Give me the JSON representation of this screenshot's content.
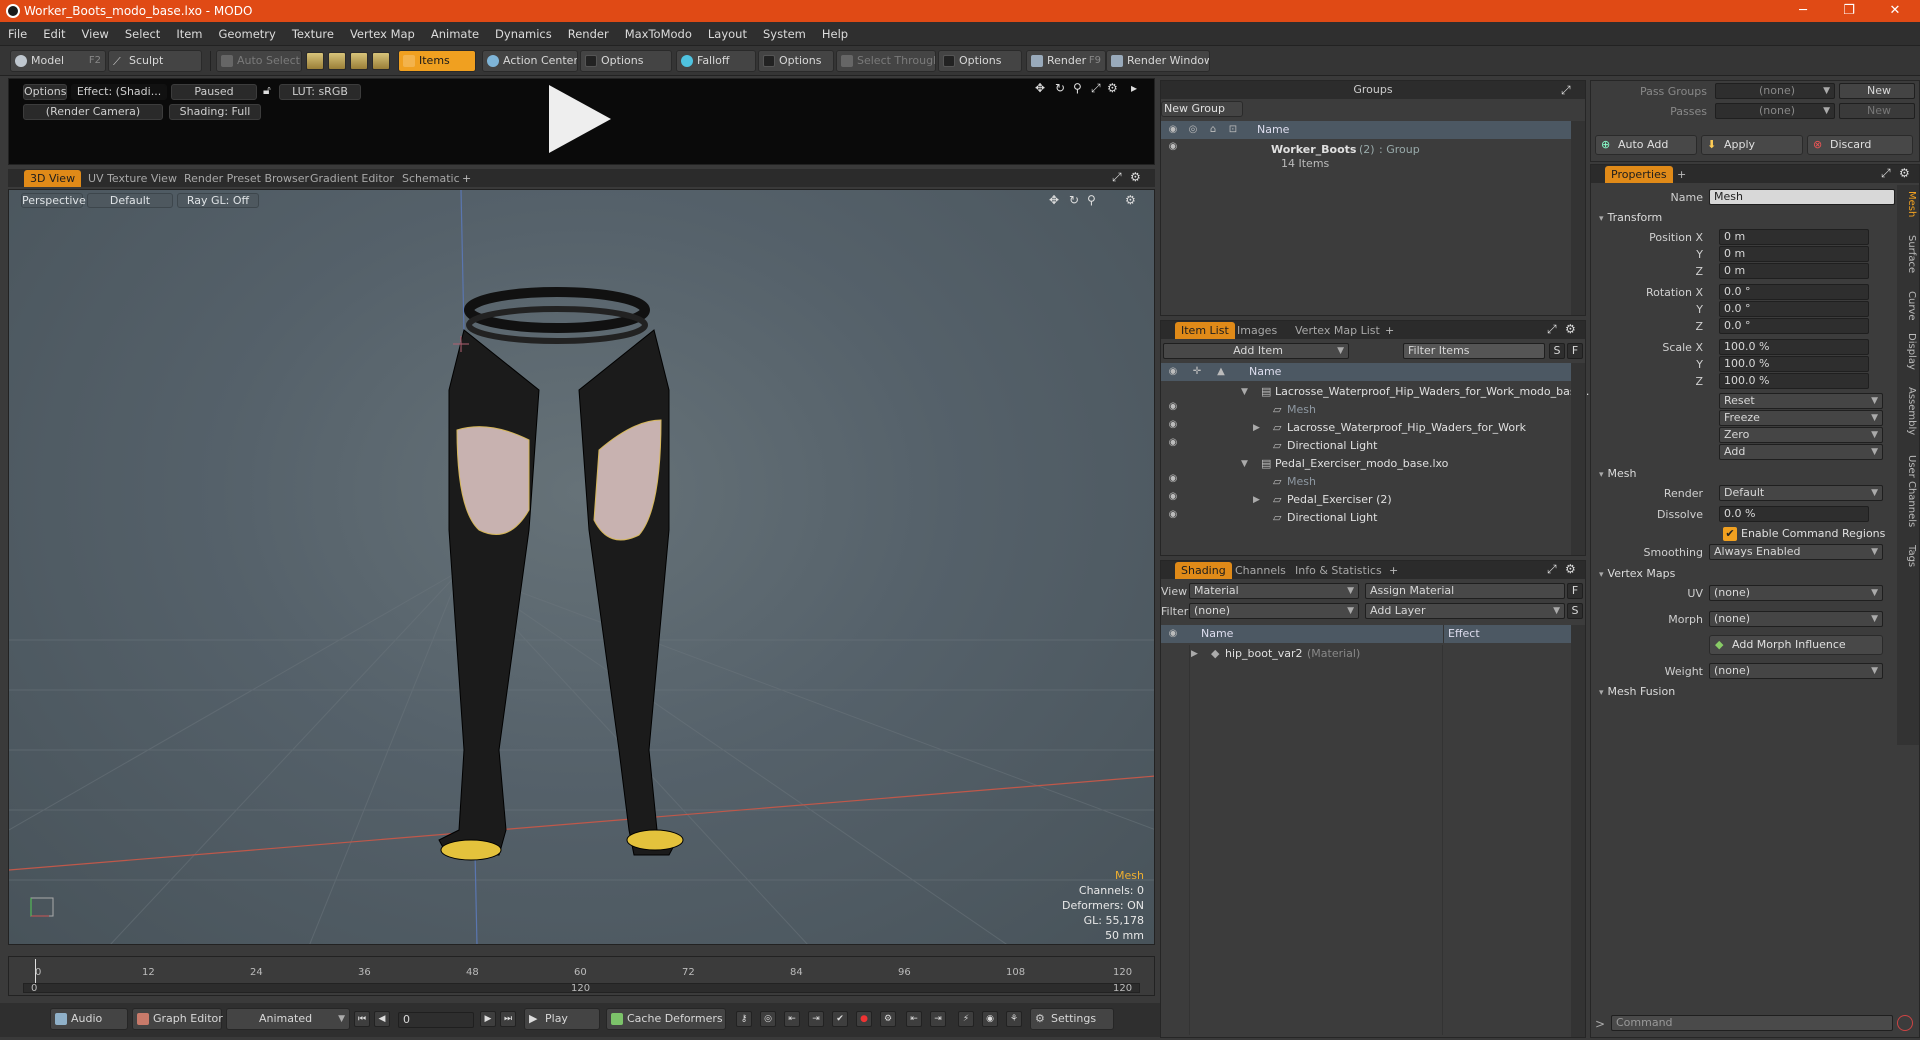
{
  "window": {
    "title": "Worker_Boots_modo_base.lxo - MODO",
    "minimize": "─",
    "maximize": "❐",
    "close": "✕"
  },
  "menu": [
    "File",
    "Edit",
    "View",
    "Select",
    "Item",
    "Geometry",
    "Texture",
    "Vertex Map",
    "Animate",
    "Dynamics",
    "Render",
    "MaxToModo",
    "Layout",
    "System",
    "Help"
  ],
  "toolbar": {
    "model": "Model",
    "model_key": "F2",
    "sculpt": "Sculpt",
    "auto_select": "Auto Select",
    "items": "Items",
    "action_center": "Action Center",
    "options1": "Options",
    "falloff": "Falloff",
    "options2": "Options",
    "select_through": "Select Through",
    "options3": "Options",
    "render": "Render",
    "render_key": "F9",
    "render_window": "Render Window"
  },
  "preview": {
    "options": "Options",
    "effect": "Effect: (Shadi...",
    "paused": "Paused",
    "lut": "LUT: sRGB",
    "camera": "(Render Camera)",
    "shading": "Shading: Full"
  },
  "viewport_tabs": [
    "3D View",
    "UV Texture View",
    "Render Preset Browser",
    "Gradient Editor",
    "Schematic",
    "+"
  ],
  "viewport": {
    "perspective": "Perspective",
    "default": "Default",
    "raygl": "Ray GL: Off",
    "stats": {
      "type": "Mesh",
      "channels": "Channels: 0",
      "deformers": "Deformers: ON",
      "gl": "GL: 55,178",
      "size": "50 mm"
    }
  },
  "timeline": {
    "ticks": [
      "0",
      "12",
      "24",
      "36",
      "48",
      "60",
      "72",
      "84",
      "96",
      "108",
      "120"
    ],
    "start": "0",
    "mid": "120",
    "end": "120"
  },
  "bottombar": {
    "audio": "Audio",
    "graph_editor": "Graph Editor",
    "animated": "Animated",
    "frame": "0",
    "play": "Play",
    "cache": "Cache Deformers",
    "settings": "Settings"
  },
  "groups": {
    "title": "Groups",
    "new_group": "New Group",
    "col_name": "Name",
    "item_name": "Worker_Boots",
    "item_count": "(2)",
    "item_type": ": Group",
    "item_sub": "14 Items"
  },
  "itemlist": {
    "tabs": [
      "Item List",
      "Images",
      "Vertex Map List",
      "+"
    ],
    "add_item": "Add Item",
    "filter": "Filter Items",
    "s": "S",
    "f": "F",
    "col_name": "Name",
    "rows": [
      {
        "text": "Lacrosse_Waterproof_Hip_Waders_for_Work_modo_base ...",
        "dim": false,
        "indent": 0,
        "arrow": "▼",
        "eye": ""
      },
      {
        "text": "Mesh",
        "dim": true,
        "indent": 1,
        "arrow": "",
        "eye": "◉"
      },
      {
        "text": "Lacrosse_Waterproof_Hip_Waders_for_Work",
        "dim": false,
        "indent": 1,
        "arrow": "▶",
        "eye": "◉"
      },
      {
        "text": "Directional Light",
        "dim": false,
        "indent": 1,
        "arrow": "",
        "eye": "◉"
      },
      {
        "text": "Pedal_Exerciser_modo_base.lxo",
        "dim": false,
        "indent": 0,
        "arrow": "▼",
        "eye": ""
      },
      {
        "text": "Mesh",
        "dim": true,
        "indent": 1,
        "arrow": "",
        "eye": "◉"
      },
      {
        "text": "Pedal_Exerciser (2)",
        "dim": false,
        "indent": 1,
        "arrow": "▶",
        "eye": "◉"
      },
      {
        "text": "Directional Light",
        "dim": false,
        "indent": 1,
        "arrow": "",
        "eye": "◉"
      }
    ]
  },
  "shading": {
    "tabs": [
      "Shading",
      "Channels",
      "Info & Statistics",
      "+"
    ],
    "view_label": "View",
    "view_value": "Material",
    "assign": "Assign Material",
    "filter_label": "Filter",
    "filter_value": "(none)",
    "add_layer": "Add Layer",
    "col_name": "Name",
    "col_effect": "Effect",
    "item": "hip_boot_var2",
    "item_type": "(Material)"
  },
  "passes": {
    "pass_groups": "Pass Groups",
    "pass_groups_val": "(none)",
    "new": "New",
    "passes": "Passes",
    "passes_val": "(none)",
    "new2": "New",
    "auto_add": "Auto Add",
    "apply": "Apply",
    "discard": "Discard"
  },
  "properties": {
    "tab": "Properties",
    "plus": "+",
    "name_label": "Name",
    "name_value": "Mesh",
    "transform": "Transform",
    "pos_label": "Position X",
    "pos": [
      "0 m",
      "0 m",
      "0 m"
    ],
    "rot_label": "Rotation X",
    "rot": [
      "0.0 °",
      "0.0 °",
      "0.0 °"
    ],
    "scale_label": "Scale X",
    "scale": [
      "100.0 %",
      "100.0 %",
      "100.0 %"
    ],
    "y": "Y",
    "z": "Z",
    "reset": "Reset",
    "freeze": "Freeze",
    "zero": "Zero",
    "add": "Add",
    "mesh": "Mesh",
    "render_label": "Render",
    "render_value": "Default",
    "dissolve_label": "Dissolve",
    "dissolve_value": "0.0 %",
    "enable_cmd": "Enable Command Regions",
    "smoothing_label": "Smoothing",
    "smoothing_value": "Always Enabled",
    "vertex_maps": "Vertex Maps",
    "uv_label": "UV",
    "uv_value": "(none)",
    "morph_label": "Morph",
    "morph_value": "(none)",
    "add_morph": "Add Morph Influence",
    "weight_label": "Weight",
    "weight_value": "(none)",
    "mesh_fusion": "Mesh Fusion",
    "side_tabs": [
      "Mesh",
      "Surface",
      "Curve",
      "Display",
      "Assembly",
      "User Channels",
      "Tags"
    ],
    "command": "Command"
  }
}
